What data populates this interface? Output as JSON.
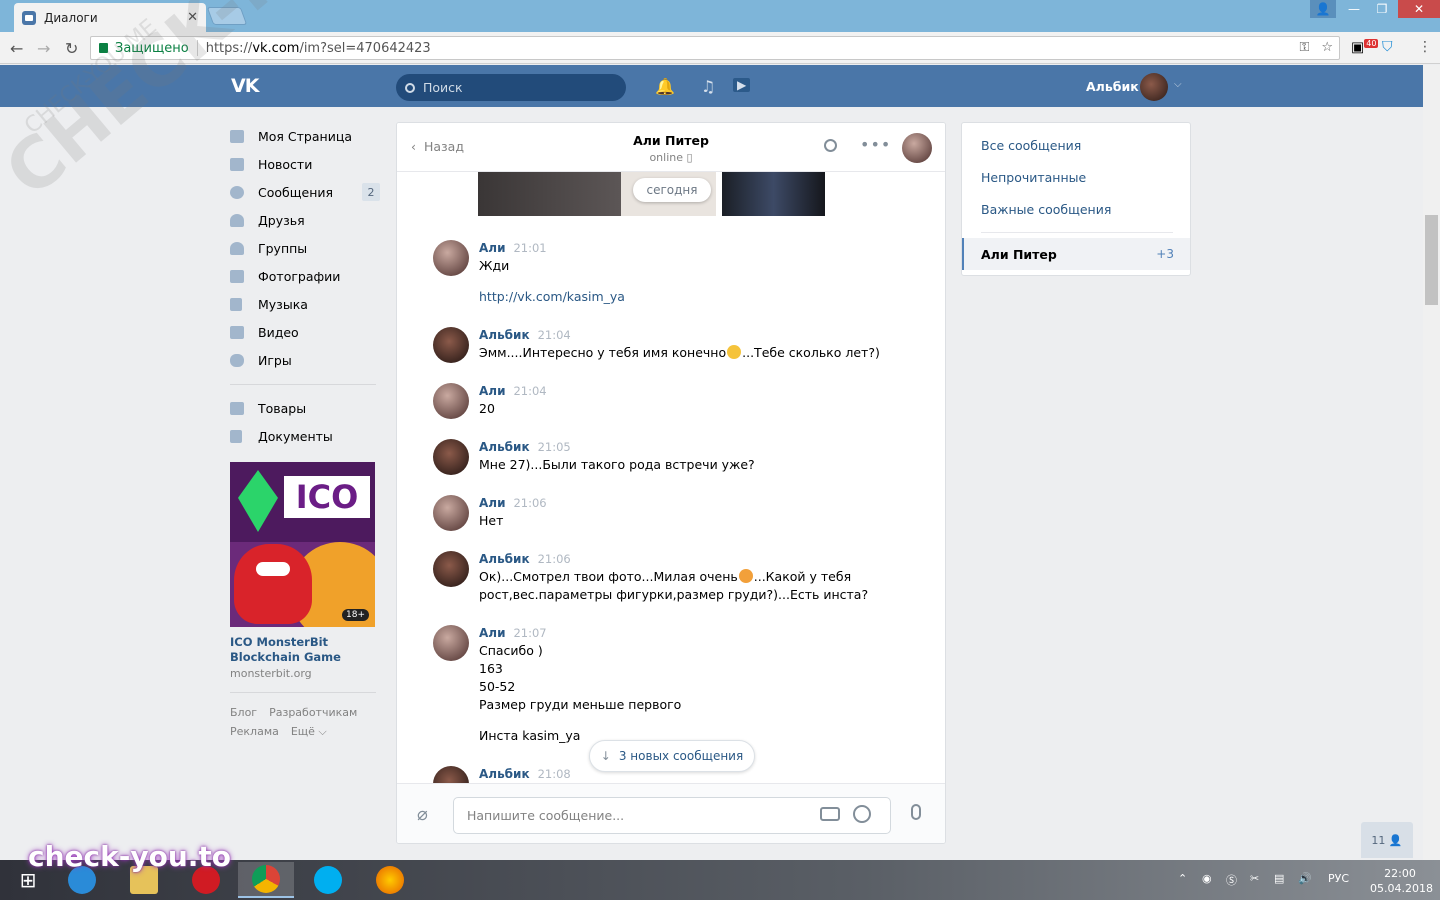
{
  "browser": {
    "tab_title": "Диалоги",
    "tab_close": "✕",
    "secure_label": "Защищено",
    "url_prefix": "https://",
    "url_host": "vk.com",
    "url_path": "/im?sel=470642423",
    "ext_badge": "40"
  },
  "header": {
    "logo": "VK",
    "search_placeholder": "Поиск",
    "user_name": "Альбик"
  },
  "menu": {
    "items": [
      {
        "label": "Моя Страница"
      },
      {
        "label": "Новости"
      },
      {
        "label": "Сообщения",
        "badge": "2"
      },
      {
        "label": "Друзья"
      },
      {
        "label": "Группы"
      },
      {
        "label": "Фотографии"
      },
      {
        "label": "Музыка"
      },
      {
        "label": "Видео"
      },
      {
        "label": "Игры"
      }
    ],
    "items2": [
      {
        "label": "Товары"
      },
      {
        "label": "Документы"
      }
    ],
    "ad": {
      "image_text": "ICO",
      "age": "18+",
      "title_line1": "ICO MonsterBit",
      "title_line2": "Blockchain Game",
      "site": "monsterbit.org"
    },
    "footer": {
      "blog": "Блог",
      "devs": "Разработчикам",
      "ads": "Реклама",
      "more": "Ещё ⌵"
    }
  },
  "dialog": {
    "back": "Назад",
    "title": "Али Питер",
    "status": "online",
    "date_pill": "сегодня",
    "messages": [
      {
        "author": "Али",
        "time": "21:01",
        "lines": [
          "Жди"
        ],
        "link": "http://vk.com/kasim_ya"
      },
      {
        "author": "Альбик",
        "time": "21:04",
        "line_a": "Эмм....Интересно у тебя имя конечно",
        "line_b": "...Тебе сколько лет?)"
      },
      {
        "author": "Али",
        "time": "21:04",
        "lines": [
          "20"
        ]
      },
      {
        "author": "Альбик",
        "time": "21:05",
        "lines": [
          "Мне 27)...Были такого рода встречи уже?"
        ]
      },
      {
        "author": "Али",
        "time": "21:06",
        "lines": [
          "Нет"
        ]
      },
      {
        "author": "Альбик",
        "time": "21:06",
        "line_a": "Ок)...Смотрел твои фото...Милая очень",
        "line_b": "...Какой у тебя",
        "line_c": "рост,вес.параметры фигурки,размер груди?)...Есть инста?"
      },
      {
        "author": "Али",
        "time": "21:07",
        "lines": [
          "Спасибо )",
          "163",
          "50-52",
          "Размер груди меньше первого"
        ],
        "extra": "Инста kasim_ya"
      },
      {
        "author": "Альбик",
        "time": "21:08"
      }
    ],
    "new_messages": "3 новых сообщения",
    "composer_placeholder": "Напишите сообщение..."
  },
  "right_panel": {
    "all": "Все сообщения",
    "unread": "Непрочитанные",
    "important": "Важные сообщения",
    "selected_name": "Али Питер",
    "selected_count": "+3"
  },
  "online_widget": "11",
  "watermark": {
    "big": "CHECK-YOU.ME",
    "small": "CHECK-YOU.ME",
    "bottom": "check-you.to"
  },
  "taskbar": {
    "lang": "РУС",
    "time": "22:00",
    "date": "05.04.2018"
  }
}
